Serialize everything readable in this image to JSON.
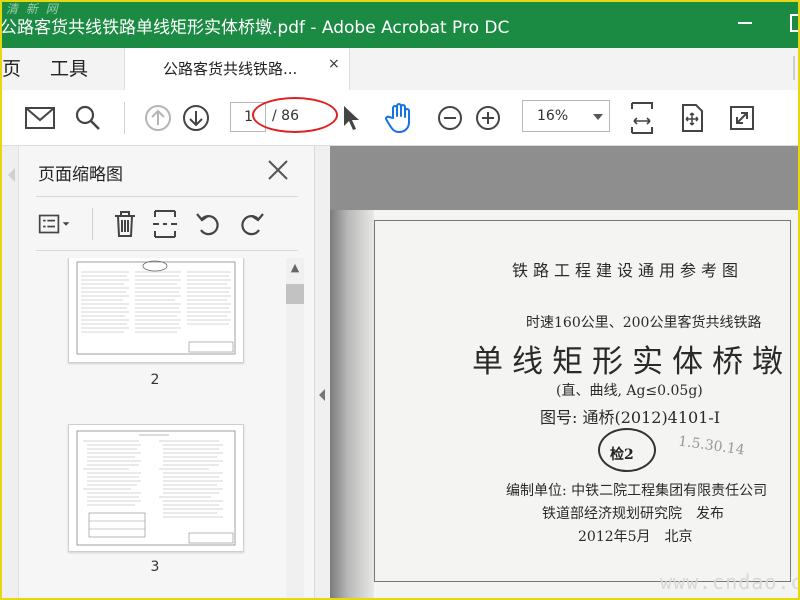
{
  "window": {
    "title": "公路客货共线铁路单线矩形实体桥墩.pdf - Adobe Acrobat Pro DC",
    "watermark_logo": "清 新 网"
  },
  "nav": {
    "home": "页",
    "tools": "工具",
    "doc_tab": "公路客货共线铁路...",
    "close_tab": "×"
  },
  "toolbar": {
    "page_current": "1",
    "page_total": "/ 86",
    "zoom": "16%"
  },
  "panel": {
    "title": "页面缩略图",
    "thumbs": [
      {
        "label": "2"
      },
      {
        "label": "3"
      }
    ]
  },
  "document": {
    "header": "铁路工程建设通用参考图",
    "subtitle": "时速160公里、200公里客货共线铁路",
    "main_title": "单线矩形实体桥墩",
    "condition": "(直、曲线, Ag≤0.05g)",
    "drawing_no": "图号: 通桥(2012)4101-Ⅰ",
    "stamp": "检2",
    "editor": "编制单位: 中铁二院工程集团有限责任公司",
    "publisher": "铁道部经济规划研究院　发布",
    "date": "2012年5月　北京",
    "handwriting": "1.5.30.14",
    "watermark": "www.cndao.com"
  },
  "colors": {
    "titlebar": "#1b8b43",
    "annotation": "#e02020",
    "hand_tool": "#1473e6",
    "frame": "#e6d80e"
  }
}
